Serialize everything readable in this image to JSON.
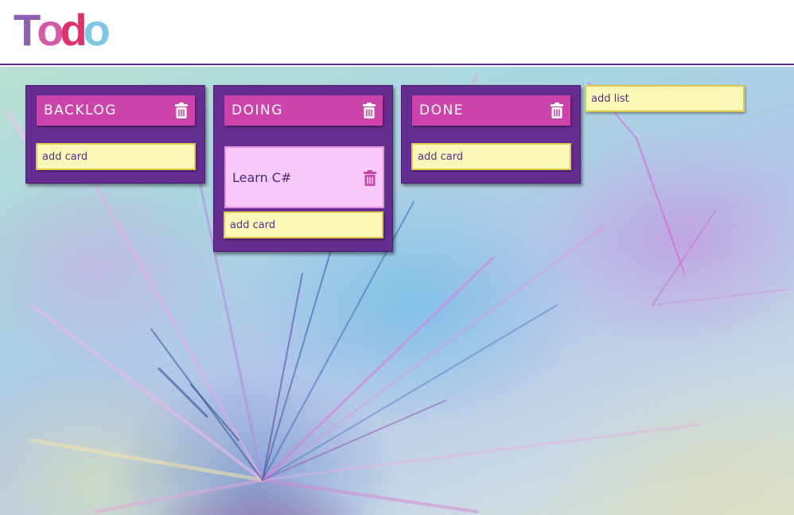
{
  "app": {
    "logo_letters": [
      "T",
      "o",
      "d",
      "o"
    ],
    "logo_colors": [
      "#8e5fb0",
      "#d45aa8",
      "#e0306e",
      "#7cc7e6"
    ]
  },
  "colors": {
    "header_border": "#5b2d8e",
    "list_bg": "#662d91",
    "list_header_bg": "#cc44aa",
    "card_bg": "#f9c9f9",
    "input_bg": "#fcf9b8",
    "trash_icon_light": "#ffffff",
    "trash_icon_card": "#cc44aa"
  },
  "lists": [
    {
      "title": "BACKLOG",
      "cards": [],
      "add_card_placeholder": "add card"
    },
    {
      "title": "DOING",
      "cards": [
        {
          "text": "Learn C#"
        }
      ],
      "add_card_placeholder": "add card"
    },
    {
      "title": "DONE",
      "cards": [],
      "add_card_placeholder": "add card"
    }
  ],
  "add_list_placeholder": "add list",
  "icons": {
    "delete_list": "trash-icon",
    "delete_card": "trash-icon"
  }
}
